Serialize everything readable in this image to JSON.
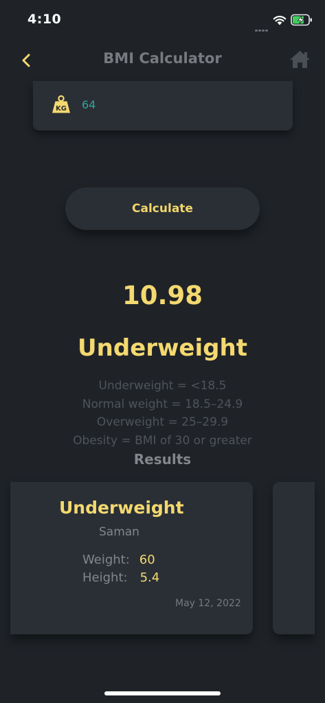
{
  "status_bar": {
    "time": "4:10",
    "icons": [
      "signal-dots-icon",
      "wifi-icon",
      "battery-charging-icon"
    ],
    "battery_color": "#3ecf5a"
  },
  "header": {
    "title": "BMI Calculator",
    "back_icon": "chevron-left-icon",
    "home_icon": "home-icon"
  },
  "weight_input": {
    "icon": "kg-weight-icon",
    "value": "64"
  },
  "calculate_label": "Calculate",
  "result": {
    "bmi": "10.98",
    "category": "Underweight"
  },
  "ranges": [
    "Underweight = <18.5",
    "Normal weight = 18.5–24.9",
    "Overweight = 25–29.9",
    "Obesity = BMI of 30 or greater"
  ],
  "results_title": "Results",
  "history": [
    {
      "category": "Underweight",
      "name": "Saman",
      "weight_label": "Weight:",
      "weight": "60",
      "height_label": "Height:",
      "height": "5.4",
      "date": "May 12, 2022"
    }
  ],
  "colors": {
    "background": "#1f2328",
    "card": "#2a2f35",
    "accent_yellow": "#f4d970",
    "teal_value": "#35a39c",
    "muted_text": "#83878b",
    "faint_text": "#4f545a"
  }
}
